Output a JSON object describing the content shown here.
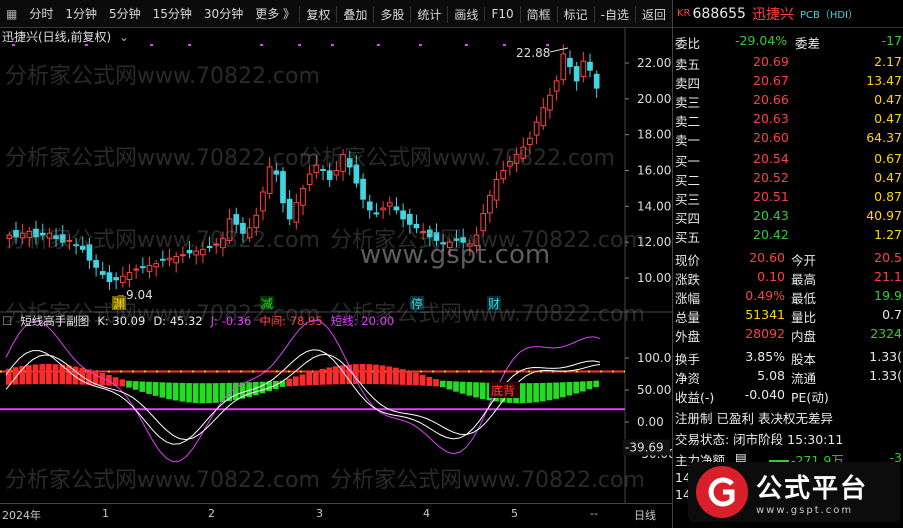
{
  "toolbar": {
    "left_items": [
      "分时",
      "1分钟",
      "5分钟",
      "15分钟",
      "30分钟",
      "更多 》"
    ],
    "right_items": [
      "复权",
      "叠加",
      "多股",
      "统计",
      "画线",
      "F10",
      "简框",
      "标记",
      "-自选",
      "返回"
    ]
  },
  "chart": {
    "title": "迅捷兴(日线,前复权)",
    "price_axis": [
      "22.00",
      "20.00",
      "18.00",
      "16.00",
      "14.00",
      "12.00",
      "10.00"
    ],
    "high_label": "22.88",
    "low_label": "9.04",
    "markers": [
      "渊",
      "减",
      "停",
      "财"
    ],
    "watermark_site": "www.gspt.com",
    "watermark_text": "分析家公式网www.70822.com",
    "date_labels": [
      "2024年",
      "1",
      "2",
      "3",
      "4",
      "5"
    ],
    "bottom_right": [
      "--",
      "日线"
    ]
  },
  "indicator": {
    "name": "短线高手副图",
    "k": "K: 30.09",
    "d": "D: 45.32",
    "j": "J: -0.36",
    "mid": "中间: 78.95",
    "short": "短线: 20.00",
    "axis": [
      "100.0",
      "50.00",
      "0.00",
      "-50.00"
    ],
    "current": "-39.69",
    "label_dibei": "底背"
  },
  "quote": {
    "exchange": "KR",
    "code": "688655",
    "name": "迅捷兴",
    "concept": "PCB（HDI）",
    "weibi_label": "委比",
    "weibi": "-29.04%",
    "weicha_label": "委差",
    "weicha": "-17",
    "sell": [
      {
        "label": "卖五",
        "price": "20.69",
        "vol": "2.17"
      },
      {
        "label": "卖四",
        "price": "20.67",
        "vol": "13.47"
      },
      {
        "label": "卖三",
        "price": "20.66",
        "vol": "0.47"
      },
      {
        "label": "卖二",
        "price": "20.63",
        "vol": "0.47"
      },
      {
        "label": "卖一",
        "price": "20.60",
        "vol": "64.37"
      }
    ],
    "buy": [
      {
        "label": "买一",
        "price": "20.54",
        "vol": "0.67"
      },
      {
        "label": "买二",
        "price": "20.52",
        "vol": "0.47"
      },
      {
        "label": "买三",
        "price": "20.51",
        "vol": "0.87"
      },
      {
        "label": "买四",
        "price": "20.43",
        "vol": "40.97"
      },
      {
        "label": "买五",
        "price": "20.42",
        "vol": "1.27"
      }
    ],
    "stats": [
      {
        "l1": "现价",
        "v1": "20.60",
        "l2": "今开",
        "v2": "20.5"
      },
      {
        "l1": "涨跌",
        "v1": "0.10",
        "l2": "最高",
        "v2": "21.1"
      },
      {
        "l1": "涨幅",
        "v1": "0.49%",
        "l2": "最低",
        "v2": "19.9"
      },
      {
        "l1": "总量",
        "v1": "51341",
        "l2": "量比",
        "v2": "0.7"
      },
      {
        "l1": "外盘",
        "v1": "28092",
        "l2": "内盘",
        "v2": "2324"
      }
    ],
    "stats2": [
      {
        "l1": "换手",
        "v1": "3.85%",
        "l2": "股本",
        "v2": "1.33("
      },
      {
        "l1": "净资",
        "v1": "5.08",
        "l2": "流通",
        "v2": "1.33("
      },
      {
        "l1": "收益(-)",
        "v1": "-0.040",
        "l2": "PE(动)",
        "v2": ""
      }
    ],
    "tags": "注册制 已盈利 表决权无差异",
    "trade_status": "交易状态: 闭市阶段 15:30:11",
    "main_force_label": "主力净额",
    "main_force_value": "-271.9万",
    "main_force_pct": "-3",
    "ticks": [
      "14",
      "14"
    ],
    "logo_text": "公式平台",
    "logo_url": "www.gspt.com"
  },
  "colors": {
    "up": "#ff4040",
    "down": "#3fd6e0",
    "green": "#33cc33",
    "yellow": "#ffd700",
    "magenta": "#e040fb"
  }
}
